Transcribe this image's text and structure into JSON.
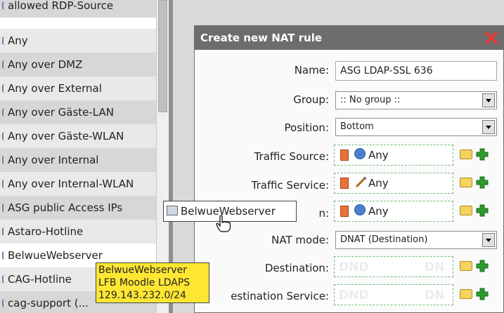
{
  "object_list": {
    "items": [
      {
        "label": "allowed RDP-Source"
      },
      {
        "label": "Any"
      },
      {
        "label": "Any over DMZ"
      },
      {
        "label": "Any over External"
      },
      {
        "label": "Any over Gäste-LAN"
      },
      {
        "label": "Any over Gäste-WLAN"
      },
      {
        "label": "Any over Internal"
      },
      {
        "label": "Any over Internal-WLAN"
      },
      {
        "label": "ASG public Access IPs"
      },
      {
        "label": "Astaro-Hotline"
      },
      {
        "label": "BelwueWebserver"
      },
      {
        "label": "CAG-Hotline"
      },
      {
        "label": "cag-support (..."
      }
    ]
  },
  "dialog": {
    "title": "Create new NAT rule",
    "name_label": "Name:",
    "name_value": "ASG LDAP-SSL 636",
    "group_label": "Group:",
    "group_value": ":: No group ::",
    "position_label": "Position:",
    "position_value": "Bottom",
    "traffic_source_label": "Traffic Source:",
    "traffic_source_value": "Any",
    "traffic_service_label": "Traffic Service:",
    "traffic_service_value": "Any",
    "traffic_dest_label": "n:",
    "traffic_dest_value": "Any",
    "nat_mode_label": "NAT mode:",
    "nat_mode_value": "DNAT (Destination)",
    "destination_label": "Destination:",
    "destination_service_label": "estination Service:",
    "dnd_placeholder": "DND",
    "dnd_placeholder_short": "DN"
  },
  "drag": {
    "chip_label": "BelwueWebserver"
  },
  "tooltip": {
    "lines": [
      "BelwueWebserver",
      "LFB Moodle LDAPS",
      "129.143.232.0/24"
    ]
  },
  "colors": {
    "title_bar": "#6d6d6d",
    "tooltip_bg": "#ffe633",
    "drop_border": "#74b874",
    "close": "#e53935",
    "add": "#2e9a2e"
  },
  "icons": {
    "close": "close-icon",
    "folder": "folder-icon",
    "add": "plus-icon",
    "trash": "trash-icon",
    "network": "network-icon",
    "service": "service-icon",
    "cursor": "hand-cursor-icon"
  }
}
